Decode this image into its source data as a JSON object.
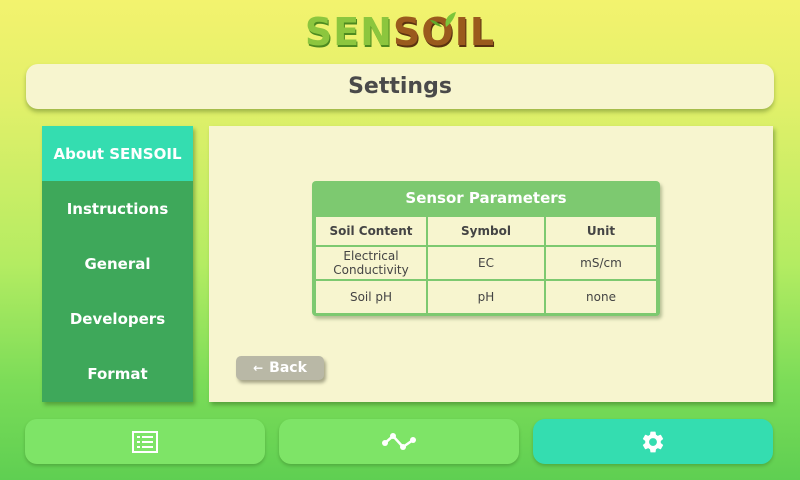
{
  "logo": {
    "part1": "SEN",
    "part2": "SOIL"
  },
  "header": {
    "title": "Settings"
  },
  "sidebar": {
    "items": [
      {
        "label": "About SENSOIL",
        "active": true
      },
      {
        "label": "Instructions",
        "active": false
      },
      {
        "label": "General",
        "active": false
      },
      {
        "label": "Developers",
        "active": false
      },
      {
        "label": "Format",
        "active": false
      }
    ]
  },
  "panel": {
    "table_title": "Sensor Parameters",
    "columns": [
      "Soil Content",
      "Symbol",
      "Unit"
    ],
    "rows": [
      [
        "Electrical Conductivity",
        "EC",
        "mS/cm"
      ],
      [
        "Soil pH",
        "pH",
        "none"
      ]
    ],
    "back_label": "Back"
  },
  "nav": {
    "buttons": [
      {
        "icon": "list-icon",
        "active": false
      },
      {
        "icon": "graph-icon",
        "active": false
      },
      {
        "icon": "gear-icon",
        "active": true
      }
    ]
  },
  "colors": {
    "accent": "#34ddb0",
    "sidebar": "#3ea85a",
    "panel": "#f7f5cf",
    "table_header": "#7dc970",
    "nav_inactive": "#7ee467"
  }
}
